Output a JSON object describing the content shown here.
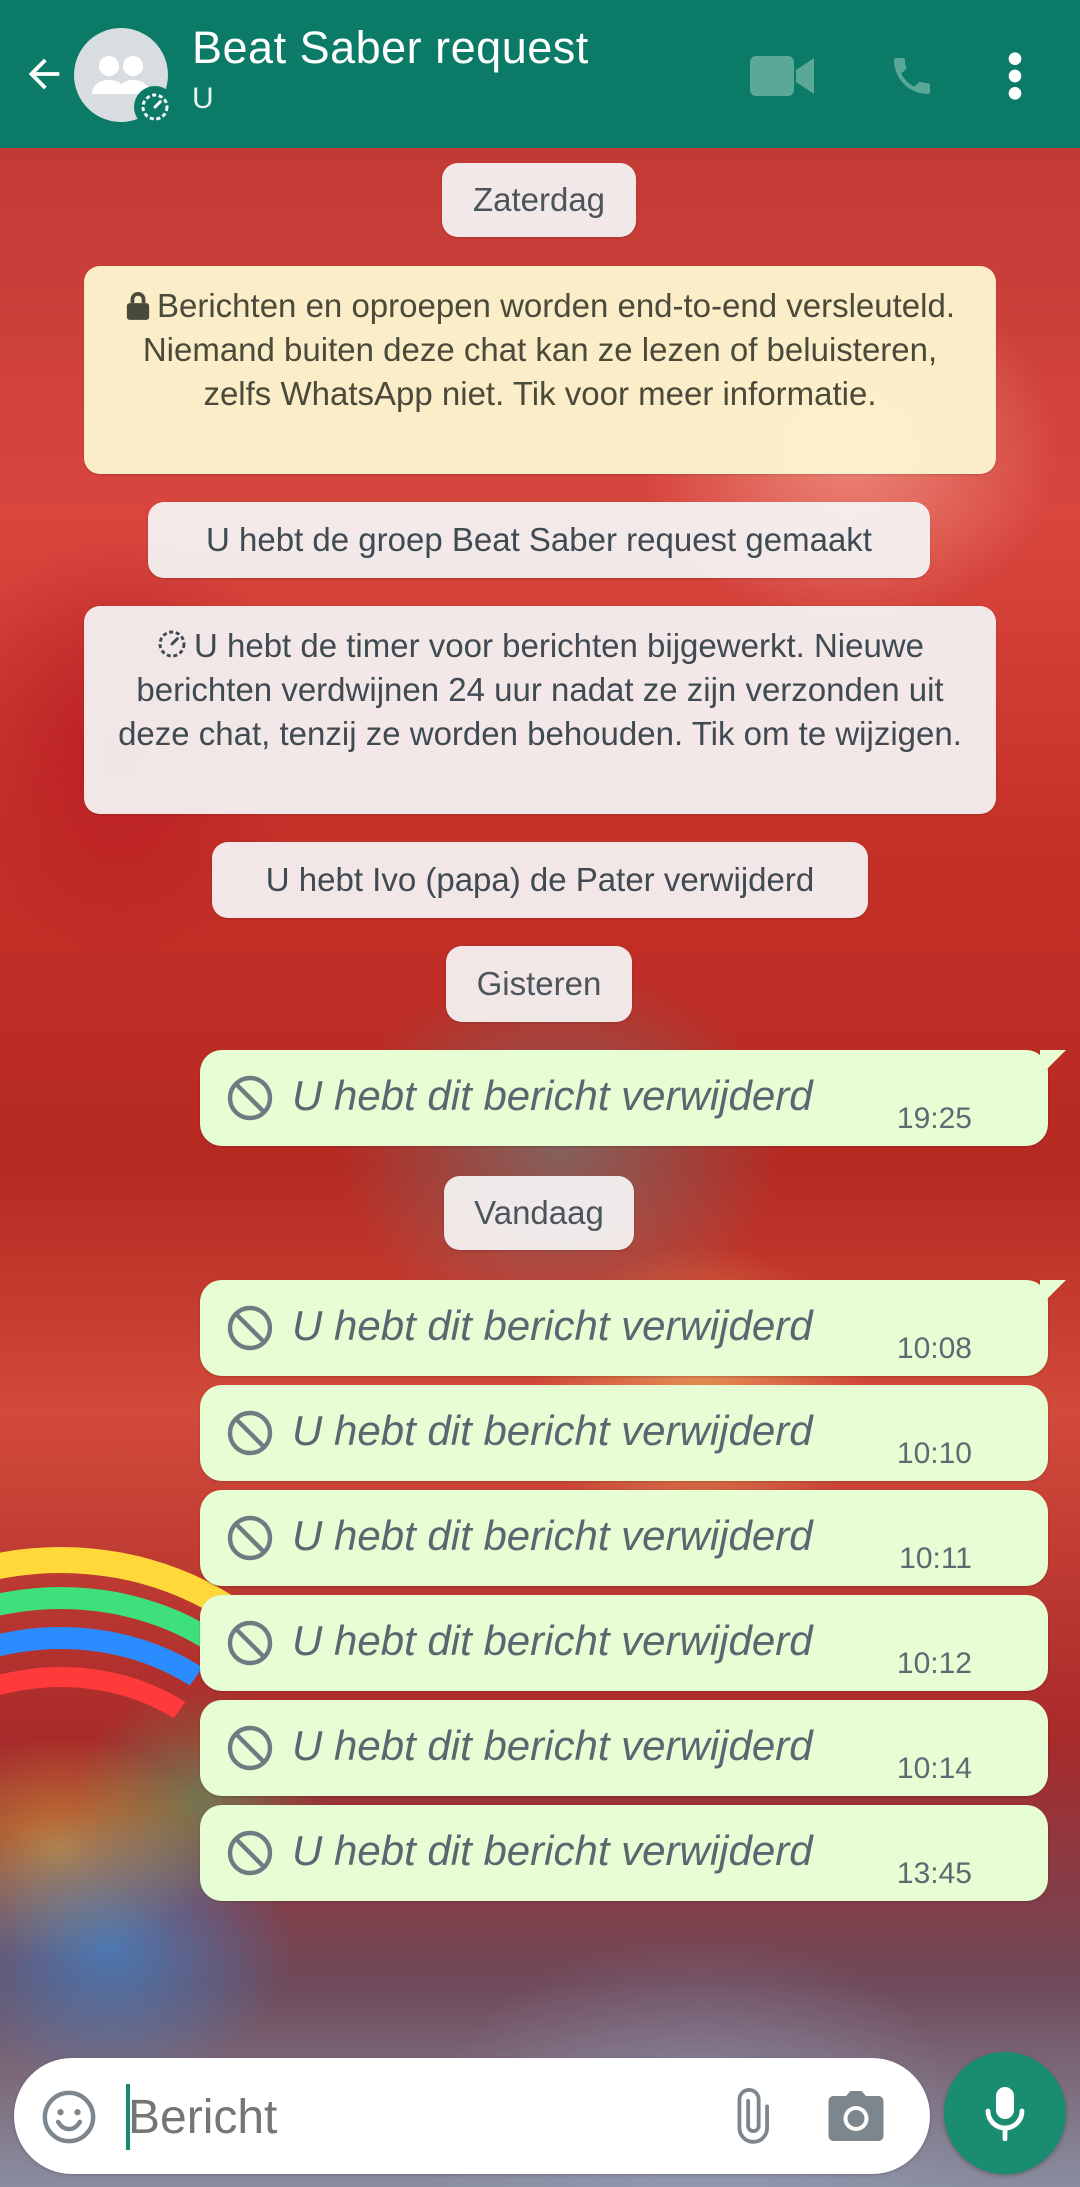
{
  "header": {
    "title": "Beat Saber request",
    "subtitle": "U",
    "back_icon": "arrow-left-icon",
    "video_icon": "video-call-icon",
    "call_icon": "phone-icon",
    "menu_icon": "more-vertical-icon"
  },
  "chips": {
    "date_saturday": "Zaterdag",
    "encryption": "Berichten en oproepen worden end-to-end versleuteld. Niemand buiten deze chat kan ze lezen of beluisteren, zelfs WhatsApp niet. Tik voor meer informatie.",
    "group_created": "U hebt de groep Beat Saber request gemaakt",
    "timer_updated": "U hebt de timer voor berichten bijgewerkt. Nieuwe berichten verdwijnen 24 uur nadat ze zijn verzonden uit deze chat, tenzij ze worden behouden. Tik om te wijzigen.",
    "removed": "U hebt Ivo (papa) de Pater verwijderd",
    "date_yesterday": "Gisteren",
    "date_today": "Vandaag"
  },
  "messages": [
    {
      "text": "U hebt dit bericht verwijderd",
      "time": "19:25"
    },
    {
      "text": "U hebt dit bericht verwijderd",
      "time": "10:08"
    },
    {
      "text": "U hebt dit bericht verwijderd",
      "time": "10:10"
    },
    {
      "text": "U hebt dit bericht verwijderd",
      "time": "10:11"
    },
    {
      "text": "U hebt dit bericht verwijderd",
      "time": "10:12"
    },
    {
      "text": "U hebt dit bericht verwijderd",
      "time": "10:14"
    },
    {
      "text": "U hebt dit bericht verwijderd",
      "time": "13:45"
    }
  ],
  "composer": {
    "placeholder": "Bericht",
    "emoji_icon": "emoji-icon",
    "attach_icon": "paperclip-icon",
    "camera_icon": "camera-icon",
    "mic_icon": "microphone-icon"
  },
  "colors": {
    "header": "#0b7a66",
    "bubble_out": "#e7fdd3",
    "mic": "#1a8c6f"
  }
}
